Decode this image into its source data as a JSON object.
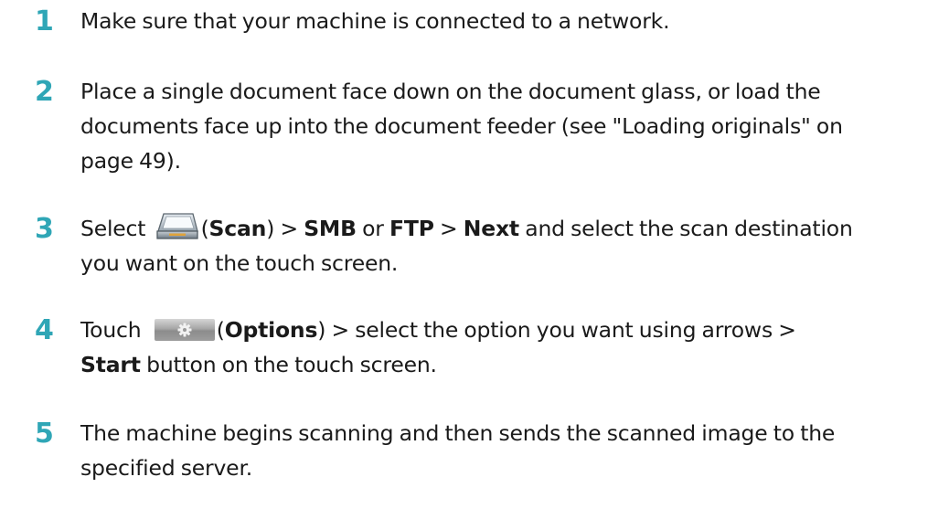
{
  "steps": [
    {
      "number": "1",
      "text": "Make sure that your machine is connected to a network."
    },
    {
      "number": "2",
      "line1": "Place a single document face down on the document glass, or load the",
      "line2": "documents face up into the document feeder (see \"Loading originals\" on",
      "line3": "page 49)."
    },
    {
      "number": "3",
      "select": "Select ",
      "scan_label": "Scan",
      "sep1": " > ",
      "smb": "SMB",
      "or": " or ",
      "ftp": "FTP",
      "sep2": " > ",
      "next": "Next",
      "rest1": " and select the scan destination",
      "line2": "you want on the touch screen.",
      "icon": "scanner-icon"
    },
    {
      "number": "4",
      "touch": "Touch ",
      "options_label": "Options",
      "rest1": " > select the option you want using arrows >",
      "start": "Start",
      "rest2": " button on the touch screen.",
      "icon": "gear-icon"
    },
    {
      "number": "5",
      "line1": "The machine begins scanning and then sends the scanned image to the",
      "line2": "specified server."
    }
  ],
  "colors": {
    "step_number": "#2fa6b6"
  }
}
